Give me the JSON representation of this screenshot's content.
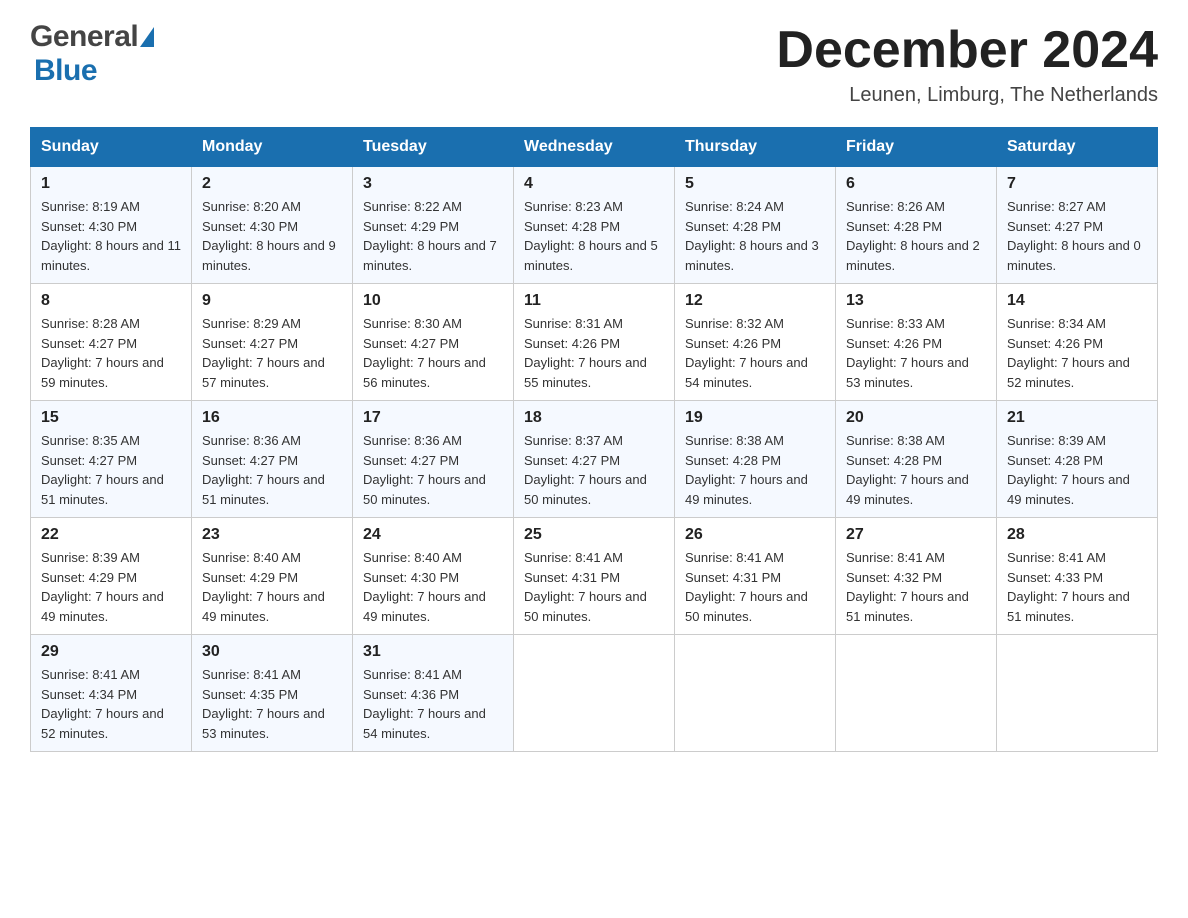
{
  "header": {
    "title": "December 2024",
    "location": "Leunen, Limburg, The Netherlands",
    "logo_general": "General",
    "logo_blue": "Blue"
  },
  "calendar": {
    "days_of_week": [
      "Sunday",
      "Monday",
      "Tuesday",
      "Wednesday",
      "Thursday",
      "Friday",
      "Saturday"
    ],
    "weeks": [
      [
        {
          "day": "1",
          "sunrise": "8:19 AM",
          "sunset": "4:30 PM",
          "daylight": "8 hours and 11 minutes."
        },
        {
          "day": "2",
          "sunrise": "8:20 AM",
          "sunset": "4:30 PM",
          "daylight": "8 hours and 9 minutes."
        },
        {
          "day": "3",
          "sunrise": "8:22 AM",
          "sunset": "4:29 PM",
          "daylight": "8 hours and 7 minutes."
        },
        {
          "day": "4",
          "sunrise": "8:23 AM",
          "sunset": "4:28 PM",
          "daylight": "8 hours and 5 minutes."
        },
        {
          "day": "5",
          "sunrise": "8:24 AM",
          "sunset": "4:28 PM",
          "daylight": "8 hours and 3 minutes."
        },
        {
          "day": "6",
          "sunrise": "8:26 AM",
          "sunset": "4:28 PM",
          "daylight": "8 hours and 2 minutes."
        },
        {
          "day": "7",
          "sunrise": "8:27 AM",
          "sunset": "4:27 PM",
          "daylight": "8 hours and 0 minutes."
        }
      ],
      [
        {
          "day": "8",
          "sunrise": "8:28 AM",
          "sunset": "4:27 PM",
          "daylight": "7 hours and 59 minutes."
        },
        {
          "day": "9",
          "sunrise": "8:29 AM",
          "sunset": "4:27 PM",
          "daylight": "7 hours and 57 minutes."
        },
        {
          "day": "10",
          "sunrise": "8:30 AM",
          "sunset": "4:27 PM",
          "daylight": "7 hours and 56 minutes."
        },
        {
          "day": "11",
          "sunrise": "8:31 AM",
          "sunset": "4:26 PM",
          "daylight": "7 hours and 55 minutes."
        },
        {
          "day": "12",
          "sunrise": "8:32 AM",
          "sunset": "4:26 PM",
          "daylight": "7 hours and 54 minutes."
        },
        {
          "day": "13",
          "sunrise": "8:33 AM",
          "sunset": "4:26 PM",
          "daylight": "7 hours and 53 minutes."
        },
        {
          "day": "14",
          "sunrise": "8:34 AM",
          "sunset": "4:26 PM",
          "daylight": "7 hours and 52 minutes."
        }
      ],
      [
        {
          "day": "15",
          "sunrise": "8:35 AM",
          "sunset": "4:27 PM",
          "daylight": "7 hours and 51 minutes."
        },
        {
          "day": "16",
          "sunrise": "8:36 AM",
          "sunset": "4:27 PM",
          "daylight": "7 hours and 51 minutes."
        },
        {
          "day": "17",
          "sunrise": "8:36 AM",
          "sunset": "4:27 PM",
          "daylight": "7 hours and 50 minutes."
        },
        {
          "day": "18",
          "sunrise": "8:37 AM",
          "sunset": "4:27 PM",
          "daylight": "7 hours and 50 minutes."
        },
        {
          "day": "19",
          "sunrise": "8:38 AM",
          "sunset": "4:28 PM",
          "daylight": "7 hours and 49 minutes."
        },
        {
          "day": "20",
          "sunrise": "8:38 AM",
          "sunset": "4:28 PM",
          "daylight": "7 hours and 49 minutes."
        },
        {
          "day": "21",
          "sunrise": "8:39 AM",
          "sunset": "4:28 PM",
          "daylight": "7 hours and 49 minutes."
        }
      ],
      [
        {
          "day": "22",
          "sunrise": "8:39 AM",
          "sunset": "4:29 PM",
          "daylight": "7 hours and 49 minutes."
        },
        {
          "day": "23",
          "sunrise": "8:40 AM",
          "sunset": "4:29 PM",
          "daylight": "7 hours and 49 minutes."
        },
        {
          "day": "24",
          "sunrise": "8:40 AM",
          "sunset": "4:30 PM",
          "daylight": "7 hours and 49 minutes."
        },
        {
          "day": "25",
          "sunrise": "8:41 AM",
          "sunset": "4:31 PM",
          "daylight": "7 hours and 50 minutes."
        },
        {
          "day": "26",
          "sunrise": "8:41 AM",
          "sunset": "4:31 PM",
          "daylight": "7 hours and 50 minutes."
        },
        {
          "day": "27",
          "sunrise": "8:41 AM",
          "sunset": "4:32 PM",
          "daylight": "7 hours and 51 minutes."
        },
        {
          "day": "28",
          "sunrise": "8:41 AM",
          "sunset": "4:33 PM",
          "daylight": "7 hours and 51 minutes."
        }
      ],
      [
        {
          "day": "29",
          "sunrise": "8:41 AM",
          "sunset": "4:34 PM",
          "daylight": "7 hours and 52 minutes."
        },
        {
          "day": "30",
          "sunrise": "8:41 AM",
          "sunset": "4:35 PM",
          "daylight": "7 hours and 53 minutes."
        },
        {
          "day": "31",
          "sunrise": "8:41 AM",
          "sunset": "4:36 PM",
          "daylight": "7 hours and 54 minutes."
        },
        null,
        null,
        null,
        null
      ]
    ]
  }
}
